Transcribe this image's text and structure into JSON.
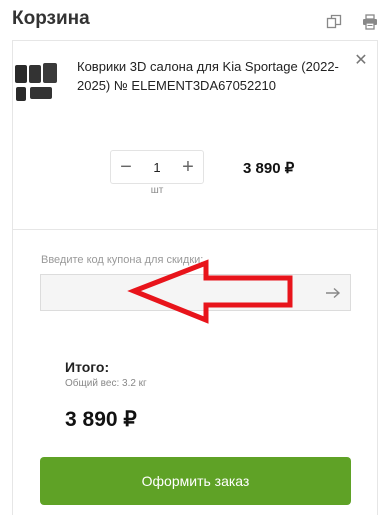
{
  "header": {
    "title": "Корзина",
    "copy_icon": "copy-icon",
    "print_icon": "print-icon"
  },
  "cart": {
    "item": {
      "name": "Коврики 3D салона для Kia Sportage (2022-2025) № ELEMENT3DA67052210",
      "quantity": "1",
      "unit": "шт",
      "price": "3 890 ₽",
      "remove_icon": "close-icon",
      "thumbnail": "floor-mats-image"
    }
  },
  "coupon": {
    "label": "Введите код купона для скидки:",
    "value": "",
    "placeholder": "",
    "submit_icon": "arrow-right-icon"
  },
  "summary": {
    "total_label": "Итого:",
    "weight": "Общий вес: 3.2 кг",
    "total_price": "3 890 ₽"
  },
  "checkout": {
    "label": "Оформить заказ"
  },
  "colors": {
    "accent_green": "#5fa226",
    "annotation_red": "#e8141b"
  }
}
